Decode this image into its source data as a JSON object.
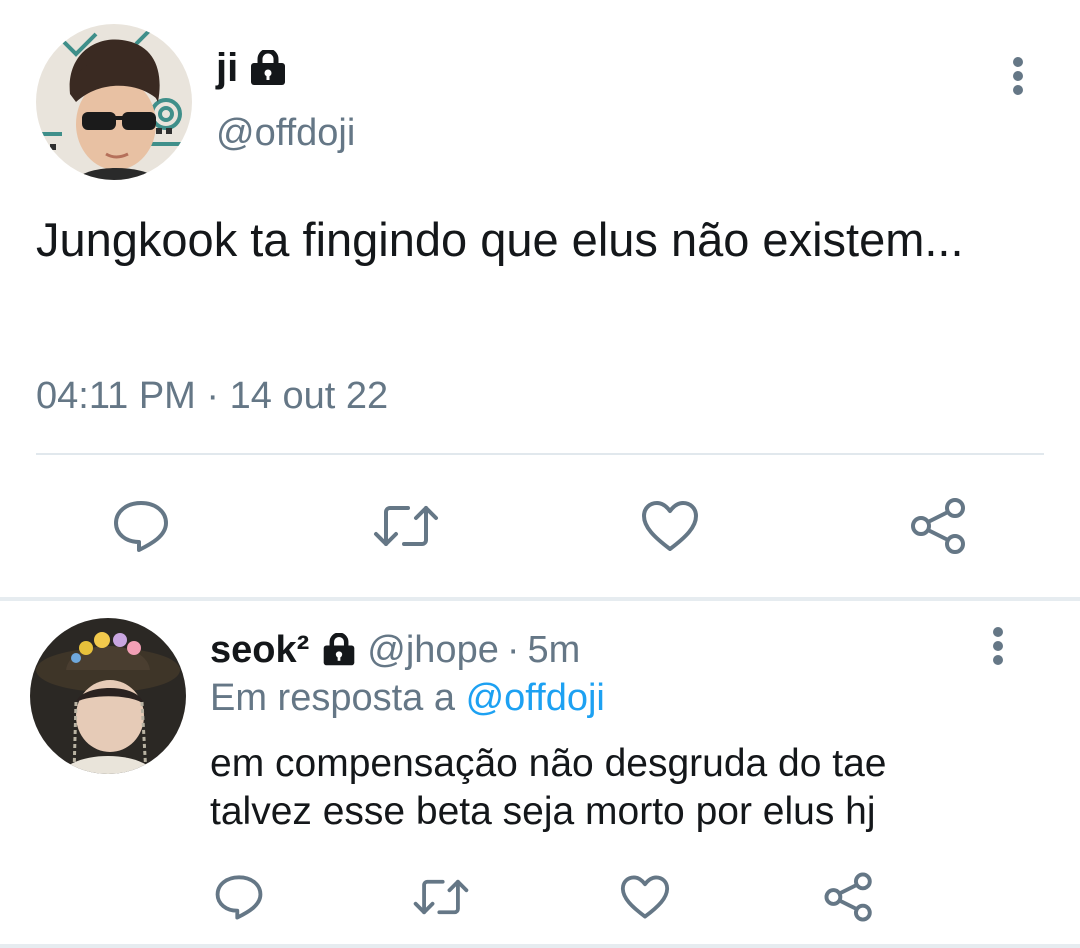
{
  "main_tweet": {
    "display_name": "ji",
    "handle": "@offdoji",
    "text": "Jungkook ta fingindo que elus não existem...",
    "time": "04:11 PM",
    "separator": "·",
    "date": "14 out 22",
    "avatar_icon": "avatar-photo",
    "lock_icon": "lock-icon",
    "more_icon": "more-vertical-icon"
  },
  "main_actions": [
    {
      "name": "reply-button",
      "icon": "comment-icon"
    },
    {
      "name": "retweet-button",
      "icon": "retweet-icon"
    },
    {
      "name": "like-button",
      "icon": "heart-icon"
    },
    {
      "name": "share-button",
      "icon": "share-icon"
    }
  ],
  "reply": {
    "display_name": "seok²",
    "handle": "@jhope",
    "separator": "·",
    "time": "5m",
    "in_reply_prefix": "Em resposta a",
    "in_reply_handle": "@offdoji",
    "text_lines": [
      "em compensação não desgruda do tae",
      "talvez esse beta seja morto por elus hj"
    ]
  },
  "reply_actions": [
    {
      "name": "reply-button",
      "icon": "comment-icon"
    },
    {
      "name": "retweet-button",
      "icon": "retweet-icon"
    },
    {
      "name": "like-button",
      "icon": "heart-icon"
    },
    {
      "name": "share-button",
      "icon": "share-icon"
    }
  ],
  "colors": {
    "text": "#14171a",
    "secondary": "#657786",
    "link": "#1da1f2",
    "divider": "#e1e8ed"
  }
}
